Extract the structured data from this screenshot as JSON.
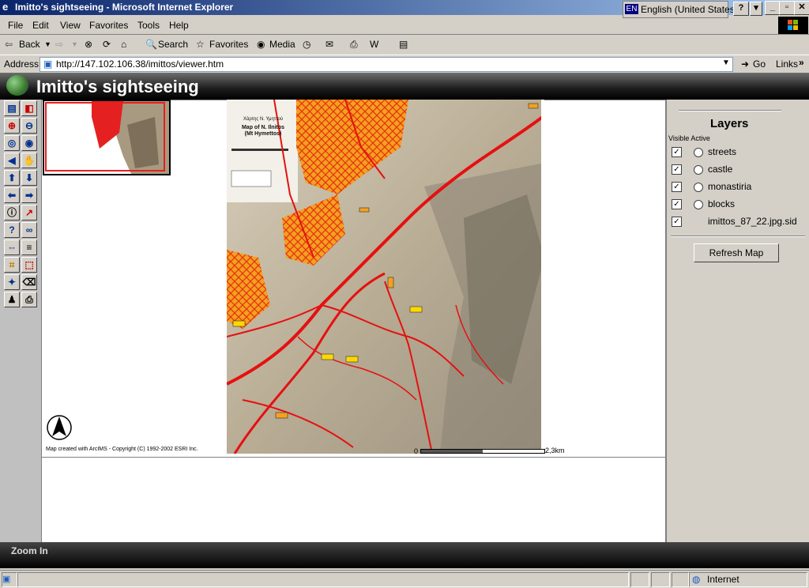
{
  "window": {
    "title": "Imitto's sightseeing - Microsoft Internet Explorer",
    "language": "English (United States)",
    "lang_code": "EN"
  },
  "menu": [
    "File",
    "Edit",
    "View",
    "Favorites",
    "Tools",
    "Help"
  ],
  "toolbar": {
    "back": "Back",
    "search": "Search",
    "favorites": "Favorites",
    "media": "Media"
  },
  "addressbar": {
    "label": "Address",
    "url": "http://147.102.106.38/imittos/viewer.htm",
    "go": "Go",
    "links": "Links"
  },
  "app": {
    "title": "Imitto's sightseeing"
  },
  "map": {
    "credit": "Map created with ArcIMS - Copyright (C) 1992-2002 ESRI Inc.",
    "scale_start": "0",
    "scale_end": "2,3km",
    "map_title": "Map of N. Ilnitos",
    "map_subtitle": "(Mt Hymettos)",
    "map_header": "Χάρτης Ν. Υμηττού"
  },
  "layers": {
    "title": "Layers",
    "col_header": "Visible Active",
    "items": [
      {
        "name": "streets",
        "visible": true,
        "has_active": true
      },
      {
        "name": "castle",
        "visible": true,
        "has_active": true
      },
      {
        "name": "monastiria",
        "visible": true,
        "has_active": true
      },
      {
        "name": "blocks",
        "visible": true,
        "has_active": true
      },
      {
        "name": "imittos_87_22.jpg.sid",
        "visible": true,
        "has_active": false
      }
    ],
    "refresh": "Refresh Map"
  },
  "footer": {
    "mode": "Zoom In"
  },
  "status": {
    "zone": "Internet"
  },
  "colors": {
    "title_blue": "#0a246a",
    "road_red": "#e61010",
    "urban_orange": "#f4a020"
  }
}
